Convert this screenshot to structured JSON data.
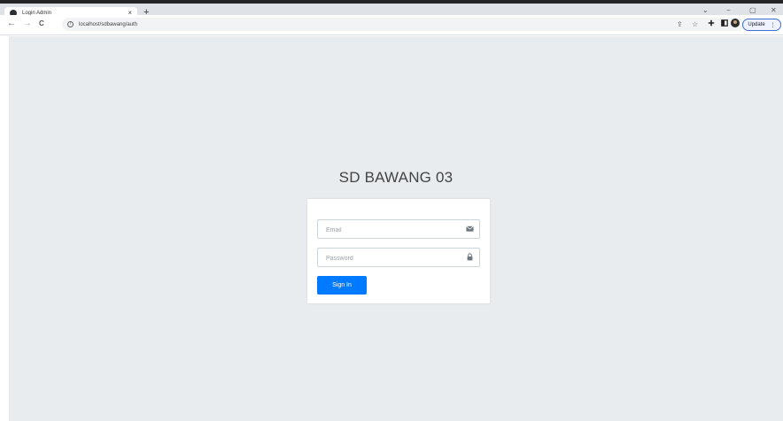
{
  "browser": {
    "tab_title": "Login Admin",
    "tab_close": "×",
    "new_tab": "+",
    "url": "localhost/sdbawang/auth",
    "update_label": "Update",
    "update_menu": "⋮",
    "icons": {
      "back": "←",
      "forward": "→",
      "reload": "C",
      "share": "⇪",
      "star": "☆",
      "minimize": "−",
      "maximize": "▢",
      "close": "✕",
      "dropdown": "⌄"
    }
  },
  "login": {
    "title": "SD BAWANG 03",
    "email_placeholder": "Email",
    "password_placeholder": "Password",
    "signin_label": "Sign In"
  },
  "colors": {
    "page_bg": "#e9ecef",
    "primary": "#007bff",
    "card_bg": "#ffffff"
  }
}
